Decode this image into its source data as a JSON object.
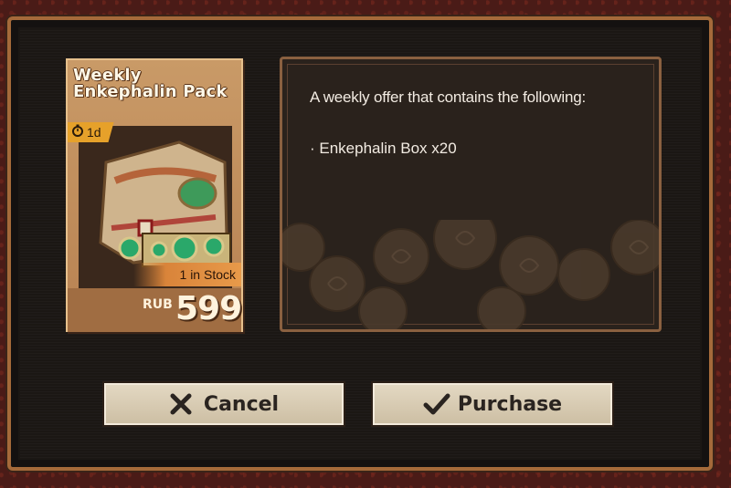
{
  "product": {
    "title": "Weekly Enkephalin Pack",
    "timer": "1d",
    "stock": "1 in Stock",
    "currency": "RUB",
    "price": "599"
  },
  "description": {
    "intro": "A weekly offer that contains the following:",
    "items": [
      "· Enkephalin Box x20"
    ]
  },
  "buttons": {
    "cancel": "Cancel",
    "purchase": "Purchase"
  },
  "icons": {
    "timer": "stopwatch-icon",
    "cancel": "x-icon",
    "purchase": "checkmark-icon"
  },
  "colors": {
    "accent": "#e6a12a",
    "frame": "#a56a3a",
    "button": "#e3d8c2"
  }
}
